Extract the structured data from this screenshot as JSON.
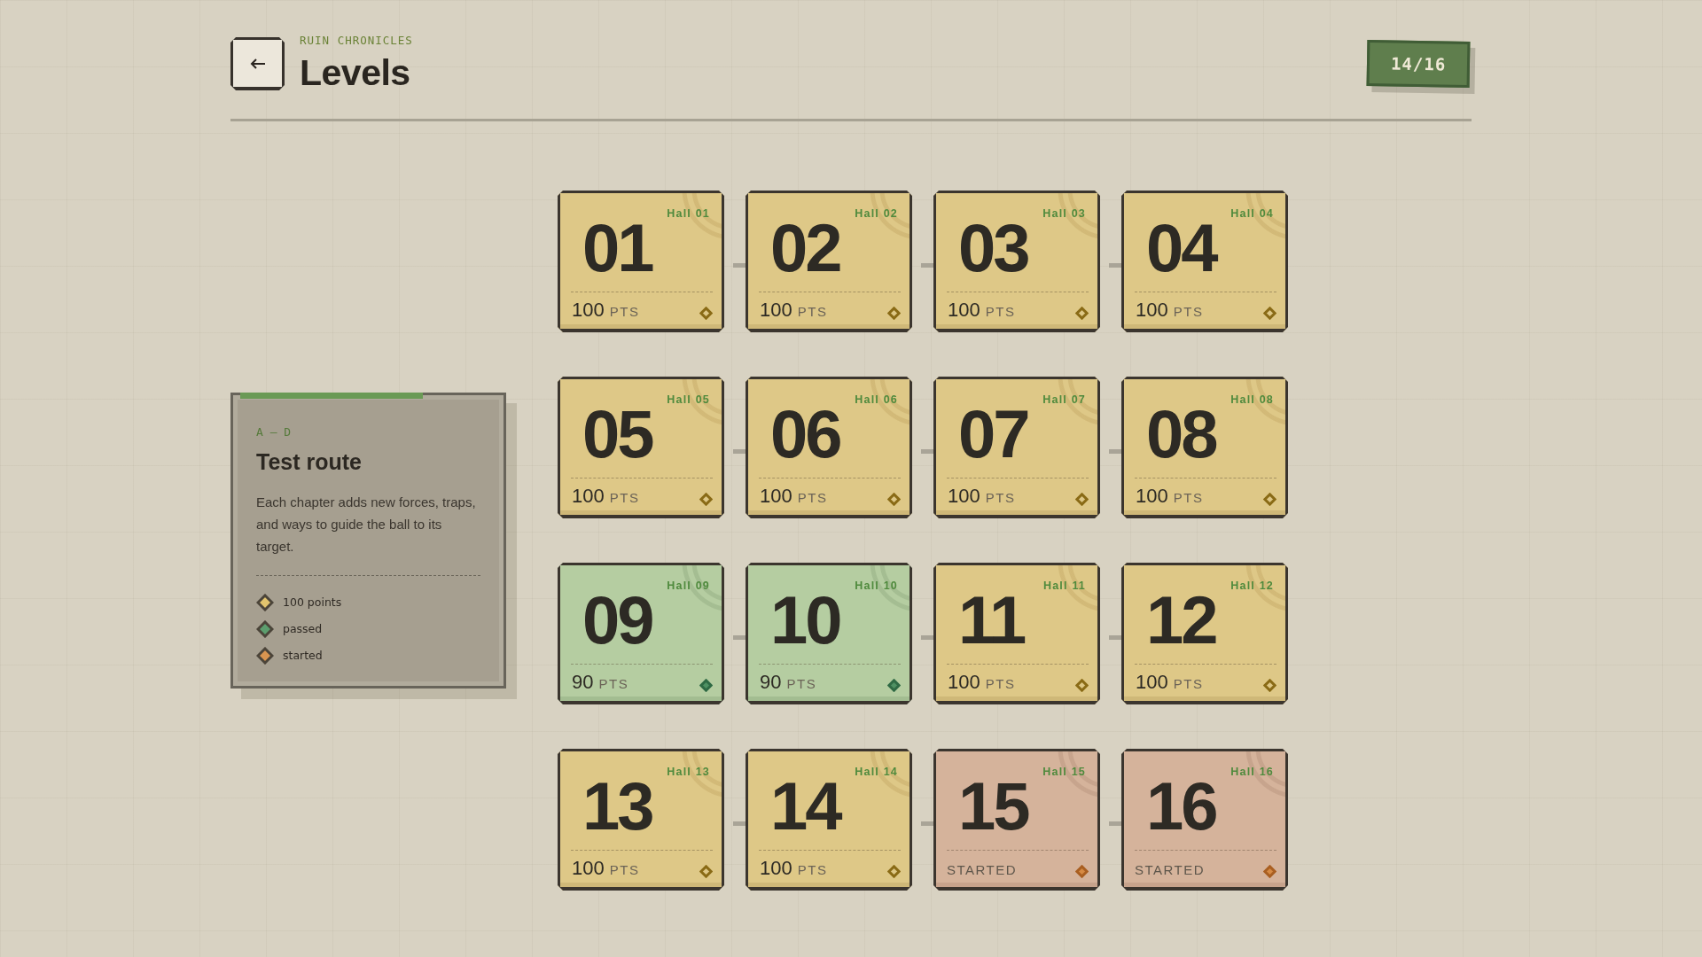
{
  "header": {
    "app_name": "RUIN CHRONICLES",
    "title": "Levels",
    "progress": "14/16"
  },
  "chapter": {
    "range": "A – D",
    "title": "Test route",
    "description": "Each chapter adds new forces, traps, and ways to guide the ball to its target.",
    "legend": [
      {
        "label": "100 points",
        "color": "#e2c46e"
      },
      {
        "label": "passed",
        "color": "#5c9e6e"
      },
      {
        "label": "started",
        "color": "#d99550"
      }
    ]
  },
  "levels": [
    {
      "number": "01",
      "hall": "Hall 01",
      "kind": "perfect",
      "points": "100",
      "unit": "PTS"
    },
    {
      "number": "02",
      "hall": "Hall 02",
      "kind": "perfect",
      "points": "100",
      "unit": "PTS"
    },
    {
      "number": "03",
      "hall": "Hall 03",
      "kind": "perfect",
      "points": "100",
      "unit": "PTS"
    },
    {
      "number": "04",
      "hall": "Hall 04",
      "kind": "perfect",
      "points": "100",
      "unit": "PTS"
    },
    {
      "number": "05",
      "hall": "Hall 05",
      "kind": "perfect",
      "points": "100",
      "unit": "PTS"
    },
    {
      "number": "06",
      "hall": "Hall 06",
      "kind": "perfect",
      "points": "100",
      "unit": "PTS"
    },
    {
      "number": "07",
      "hall": "Hall 07",
      "kind": "perfect",
      "points": "100",
      "unit": "PTS"
    },
    {
      "number": "08",
      "hall": "Hall 08",
      "kind": "perfect",
      "points": "100",
      "unit": "PTS"
    },
    {
      "number": "09",
      "hall": "Hall 09",
      "kind": "passed",
      "points": "90",
      "unit": "PTS"
    },
    {
      "number": "10",
      "hall": "Hall 10",
      "kind": "passed",
      "points": "90",
      "unit": "PTS"
    },
    {
      "number": "11",
      "hall": "Hall 11",
      "kind": "perfect",
      "points": "100",
      "unit": "PTS"
    },
    {
      "number": "12",
      "hall": "Hall 12",
      "kind": "perfect",
      "points": "100",
      "unit": "PTS"
    },
    {
      "number": "13",
      "hall": "Hall 13",
      "kind": "perfect",
      "points": "100",
      "unit": "PTS"
    },
    {
      "number": "14",
      "hall": "Hall 14",
      "kind": "perfect",
      "points": "100",
      "unit": "PTS"
    },
    {
      "number": "15",
      "hall": "Hall 15",
      "kind": "started",
      "label": "STARTED"
    },
    {
      "number": "16",
      "hall": "Hall 16",
      "kind": "started",
      "label": "STARTED"
    }
  ]
}
